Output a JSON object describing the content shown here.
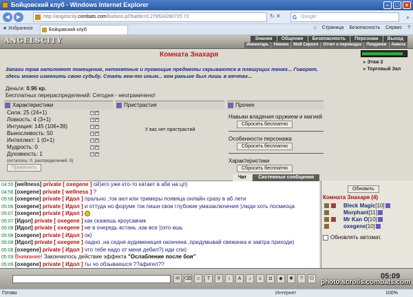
{
  "browser": {
    "title": "Бойцовский клуб - Windows Internet Explorer",
    "address_prefix": "http://angelscity.",
    "address_domain": "combats.com",
    "address_rest": "/buttons.pl?battle=0.279524280725 72",
    "search_placeholder": "Google",
    "favorites_label": "Избранное",
    "tab_title": "Бойцовский клуб",
    "commands": [
      "Страница",
      "Безопасность",
      "Сервис"
    ],
    "status_text": "Готово",
    "zone": "Интернет",
    "zoom": "100%"
  },
  "game": {
    "logo": "ANGELSCITY",
    "menu_top": [
      "Знания",
      "Общение",
      "Безопасность",
      "Персонаж",
      "Выход"
    ],
    "menu_bottom": [
      "Инвентарь",
      "Умения",
      "Мой Скролл",
      "Отчет о переводах",
      "Поединки",
      "Анкета"
    ],
    "hp_fraction": 0.92,
    "room_nav": [
      "Этаж 2",
      "Торговый Зал"
    ],
    "room_title": "Комната Знахаря",
    "description": "Запахи трав наполняют помещение, непонятные и пугающие предметы скрываются в пляшущих тенях... Говорят, здесь можно изменить свою судьбу. Стать кем-то иным... кем раньше был лишь в мечтах...",
    "money_label": "Деньги:",
    "money_value": "0.96 кр.",
    "free_redist": "Бесплатных перераспределений: Сегодня - неограничено!",
    "stats_header": "Характеристики",
    "stats": [
      {
        "label": "Сила: 25 (24+1)"
      },
      {
        "label": "Ловкость: 4 (3+1)"
      },
      {
        "label": "Интуиция: 145 (106+39)"
      },
      {
        "label": "Выносливость: 50"
      },
      {
        "label": "Интеллект: 1 (0+1)"
      },
      {
        "label": "Мудрость: 0"
      },
      {
        "label": "Духовность: 1"
      }
    ],
    "stats_remaining": "(осталось: 0, распределений: 0)",
    "apply_button": "Применить",
    "addict_header": "Пристрастия",
    "addict_none": "У вас нет пристрастий",
    "other_header": "Прочее",
    "other_sections": [
      {
        "title": "Навыки владения оружием и магией",
        "button": "Сбросить бесплатно"
      },
      {
        "title": "Особенности персонажа",
        "button": "Сбросить бесплатно"
      },
      {
        "title": "Характеристики",
        "button": "Сбросить бесплатно"
      }
    ]
  },
  "chat": {
    "tabs": [
      "Чат",
      "Системные сообщения"
    ],
    "messages": [
      {
        "time": "04:55",
        "from": "[wellness]",
        "priv": "private [ oxegene ]",
        "text": "ой)его уже кто-то катает в абе на цп)"
      },
      {
        "time": "04:56",
        "from": "[oxegene]",
        "priv": "private [ wellness ]",
        "text": "?"
      },
      {
        "time": "05:06",
        "from": "[oxegene]",
        "priv": "private [ Идол ]",
        "text": "прально ,ток аел или тримеры появяца онлайн сразу в аб лети"
      },
      {
        "time": "05:06",
        "from": "[oxegene]",
        "priv": "private [ Идол ]",
        "text": "и оттуда но форуме ток пиши свои глубокие умазаключения )люди хоть посмиоца"
      },
      {
        "time": "05:07",
        "from": "[oxegene]",
        "priv": "private [ Идол ]",
        "text": ""
      },
      {
        "time": "05:07",
        "from": "[Идол]",
        "priv": "private [ oxegene ]",
        "text": "как скажешь кроусавчик"
      },
      {
        "time": "05:08",
        "from": "[Идол]",
        "priv": "private [ oxegene ]",
        "text": "не в очередь встань ,как все ))это ишь"
      },
      {
        "time": "05:08",
        "from": "[oxegene]",
        "priv": "private [ Идол ]",
        "text": "ок)"
      },
      {
        "time": "05:08",
        "from": "[Идол]",
        "priv": "private [ oxegene ]",
        "text": "ладно ,на седня аудимениция окончена ,придумывай свежачка и завтра приходи)"
      },
      {
        "time": "05:08",
        "from": "[oxegene]",
        "priv": "private [ Идол ]",
        "text": "что тебе надо от меня дебил?) иди спи)"
      },
      {
        "time": "05:09",
        "system_label": "Внимание!",
        "text": "Закончилось действие эффекта",
        "bold": "\"Ослабление после боя\""
      },
      {
        "time": "05:09",
        "from": "[oxegene]",
        "priv": "private [ Идол ]",
        "text": "ты чо обзываешся ??афигел??"
      }
    ]
  },
  "online": {
    "refresh": "Обновить",
    "title": "Комната Знахаря (4)",
    "players": [
      {
        "name": "Bleck Magic",
        "level": "[10]"
      },
      {
        "name": "Morphant",
        "level": "[11]"
      },
      {
        "name": "Mr Kan O",
        "level": "[10]"
      },
      {
        "name": "oxegene",
        "level": "[10]"
      }
    ],
    "auto": "Обновлять автомат."
  },
  "clock": "05:09",
  "watermark": "photo.scrolls.combats.com"
}
